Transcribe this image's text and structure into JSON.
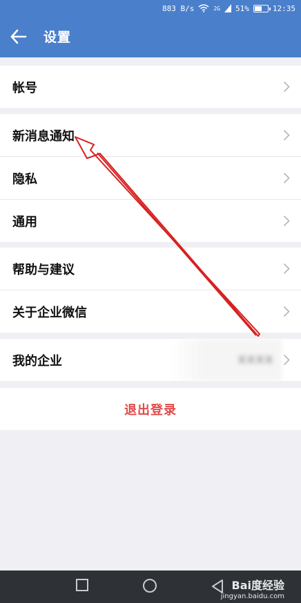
{
  "status_bar": {
    "speed": "883 B/s",
    "network": "2G",
    "battery": "51%",
    "time": "12:35",
    "icons": [
      "wifi-icon",
      "signal-icon",
      "battery-icon"
    ]
  },
  "header": {
    "back_icon": "back-arrow-icon",
    "title": "设置"
  },
  "groups": [
    {
      "items": [
        {
          "label": "帐号"
        }
      ]
    },
    {
      "items": [
        {
          "label": "新消息通知"
        },
        {
          "label": "隐私"
        },
        {
          "label": "通用"
        }
      ]
    },
    {
      "items": [
        {
          "label": "帮助与建议"
        },
        {
          "label": "关于企业微信"
        }
      ]
    },
    {
      "items": [
        {
          "label": "我的企业",
          "value": "某某某某"
        }
      ]
    }
  ],
  "logout": {
    "label": "退出登录"
  },
  "annotation": {
    "type": "arrow",
    "color": "#d6201f"
  },
  "nav_bar": {
    "icons": [
      "recent-apps-icon",
      "home-icon",
      "back-icon"
    ]
  },
  "watermark": {
    "brand": "Bai度经验",
    "site": "jingyan.baidu.com"
  },
  "colors": {
    "header": "#4a7fcb",
    "logout_text": "#e24a4a",
    "background": "#efeff4"
  }
}
